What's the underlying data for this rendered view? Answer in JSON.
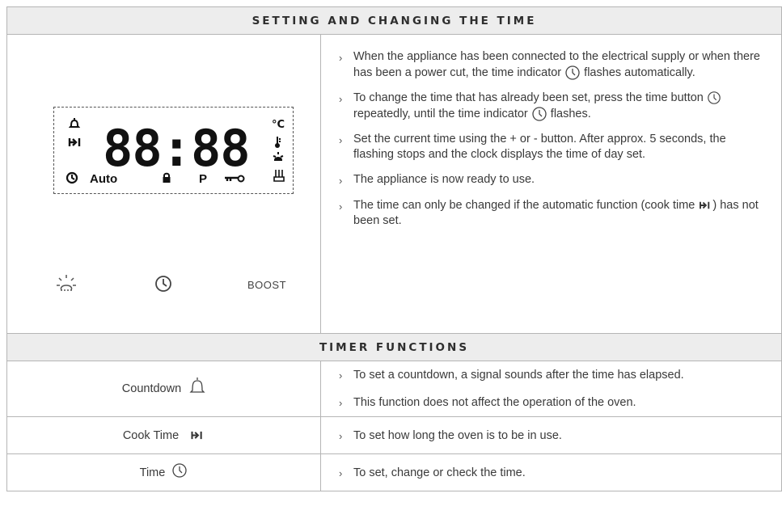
{
  "section_time": {
    "title": "SETTING AND CHANGING THE TIME",
    "display": {
      "digits": "88:88",
      "auto_label": "Auto",
      "p_label": "P",
      "celsius_label": "°C"
    },
    "buttons": {
      "boost_label": "BOOST"
    },
    "bullets": [
      {
        "text_before": "When the appliance has been connected to the electrical supply or when there has been a power cut, the time indicator ",
        "text_after": " flashes automatically."
      },
      {
        "text_before": "To change the time that has already been set, press the time button ",
        "text_middle": " repeatedly, until the time indicator ",
        "text_after": " flashes."
      },
      {
        "text": "Set the current time using the + or - button. After approx. 5 seconds, the flashing stops and the clock displays the time of day set."
      },
      {
        "text": "The appliance is now ready to use."
      },
      {
        "text_before": "The time can only be changed if the automatic function (cook time ",
        "text_after": ") has not been set."
      }
    ]
  },
  "section_timer": {
    "title": "TIMER FUNCTIONS",
    "rows": [
      {
        "label": "Countdown",
        "icon": "bell-icon",
        "bullets": [
          "To set a countdown, a signal sounds after the time has elapsed.",
          "This function does not affect the operation of the oven."
        ]
      },
      {
        "label": "Cook Time",
        "icon": "cook-time-icon",
        "bullets": [
          "To set how long the oven is to be in use."
        ]
      },
      {
        "label": "Time",
        "icon": "clock-icon",
        "bullets": [
          "To set, change or check the time."
        ]
      }
    ]
  },
  "bullet_marker": "›"
}
